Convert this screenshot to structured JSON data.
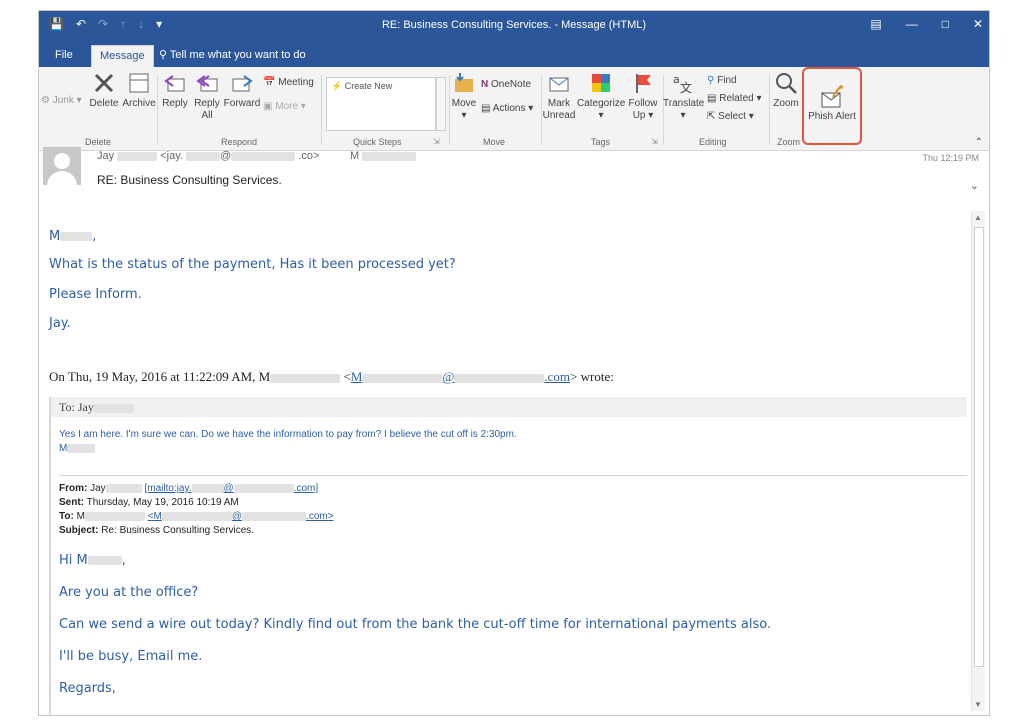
{
  "window": {
    "title": "RE: Business Consulting Services. - Message (HTML)"
  },
  "colors": {
    "titlebar": "#2b579a",
    "link": "#2d5fa6",
    "highlight": "#e0563b"
  },
  "tabs": [
    {
      "label": "File"
    },
    {
      "label": "Message"
    },
    {
      "label": "Tell me what you want to do"
    }
  ],
  "ribbon": {
    "delete_group": {
      "junk_label": "Junk",
      "delete_label": "Delete",
      "archive_label": "Archive",
      "group_label": "Delete"
    },
    "respond_group": {
      "reply_label": "Reply",
      "reply_all_label": "Reply All",
      "forward_label": "Forward",
      "meeting_label": "Meeting",
      "more_label": "More",
      "group_label": "Respond"
    },
    "quick_steps": {
      "item": "Create New",
      "group_label": "Quick Steps"
    },
    "move_group": {
      "move_label": "Move",
      "onenote_label": "OneNote",
      "actions_label": "Actions",
      "group_label": "Move"
    },
    "tags_group": {
      "mark_unread_label": "Mark Unread",
      "categorize_label": "Categorize",
      "follow_up_label": "Follow Up",
      "group_label": "Tags"
    },
    "editing_group": {
      "translate_label": "Translate",
      "find_label": "Find",
      "related_label": "Related",
      "select_label": "Select",
      "group_label": "Editing"
    },
    "zoom_group": {
      "zoom_label": "Zoom",
      "group_label": "Zoom"
    },
    "phish_alert_label": "Phish Alert"
  },
  "header": {
    "from_name": "Jay",
    "from_email_prefix": "<jay.",
    "from_email_domain": ".co>",
    "to_initial": "M",
    "subject": "RE: Business Consulting Services.",
    "date": "Thu 12:19 PM"
  },
  "body": {
    "greeting": "M",
    "line1": "What is the status of the payment, Has it been processed yet?",
    "line2": "Please Inform.",
    "signature": "Jay."
  },
  "quoted": {
    "wrote_prefix": "On Thu, 19 May, 2016 at 11:22:09 AM, M",
    "wrote_email_start": "M",
    "wrote_email_end": ".com",
    "wrote_suffix": "> wrote:",
    "to_line": "To: Jay",
    "reply_text": "Yes I am here.  I'm sure we can.  Do we have the information to pay from?  I believe the cut off is 2:30pm.",
    "reply_sig": "M",
    "from_label": "From:",
    "from_value": "Jay",
    "mailto_prefix": "[mailto:jay.",
    "mailto_suffix": ".com]",
    "sent_label": "Sent:",
    "sent_value": "Thursday, May 19, 2016 10:19 AM",
    "to_label": "To:",
    "to_value": "M",
    "to_email_start": "<M",
    "to_email_end": ".com>",
    "subject_label": "Subject:",
    "subject_value": "Re: Business Consulting Services.",
    "hi": "Hi M",
    "q1": "Are you at the office?",
    "q2": "Can we send a wire out today? Kindly find out from the bank the cut-off time for international payments also.",
    "q3": "I'll be busy, Email me.",
    "q4": "Regards,"
  }
}
